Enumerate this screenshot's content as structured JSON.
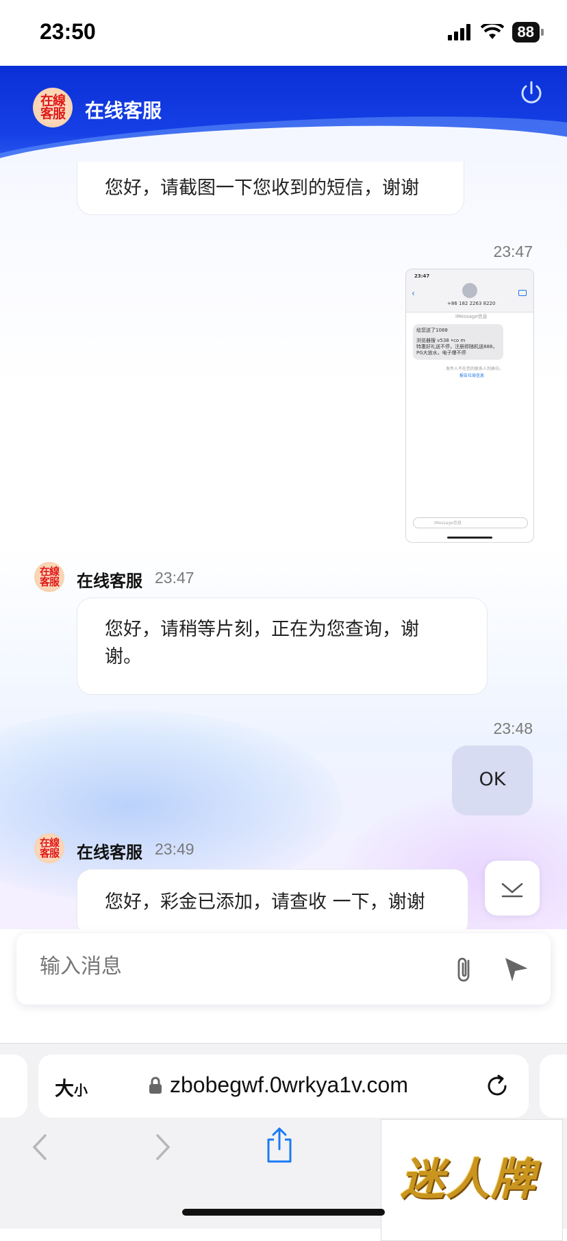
{
  "status_bar": {
    "time": "23:50",
    "battery": "88"
  },
  "header": {
    "logo_text": "在線客服",
    "title": "在线客服"
  },
  "messages": [
    {
      "from": "agent",
      "text": "您好，请截图一下您收到的短信，谢谢"
    },
    {
      "from": "me",
      "time": "23:47",
      "type": "image",
      "image": {
        "time": "23:47",
        "sender": "+86 182 2263 8220",
        "service": "iMessage信息",
        "msg_line1": "给您送了1088",
        "msg_line2": "浏览器搜 v538 •co m",
        "msg_line3": "特惠好礼送不停，注册即随机送888，PG大放水，电子爆不停",
        "footer": "发件人不在您的联系人列表中。",
        "report": "报告垃圾信息",
        "input_placeholder": "iMessage信息"
      }
    },
    {
      "from": "agent",
      "sender": "在线客服",
      "time": "23:47",
      "text": "您好，请稍等片刻，正在为您查询，谢谢。"
    },
    {
      "from": "me",
      "time": "23:48",
      "text": "OK"
    },
    {
      "from": "agent",
      "sender": "在线客服",
      "time": "23:49",
      "text": "您好，彩金已添加，请查收 一下，谢谢"
    }
  ],
  "composer": {
    "placeholder": "输入消息"
  },
  "browser": {
    "size_label_big": "大",
    "size_label_small": "小",
    "url": "zbobegwf.0wrkya1v.com"
  },
  "watermark": {
    "text": "迷人牌"
  },
  "colors": {
    "header_blue": "#0a2fd6",
    "my_bubble": "#d8dcf2",
    "logo_red": "#e01818"
  },
  "icons": [
    "power-icon",
    "attach-icon",
    "send-icon",
    "scroll-down-icon",
    "lock-icon",
    "reload-icon",
    "back-icon",
    "forward-icon",
    "share-icon"
  ]
}
